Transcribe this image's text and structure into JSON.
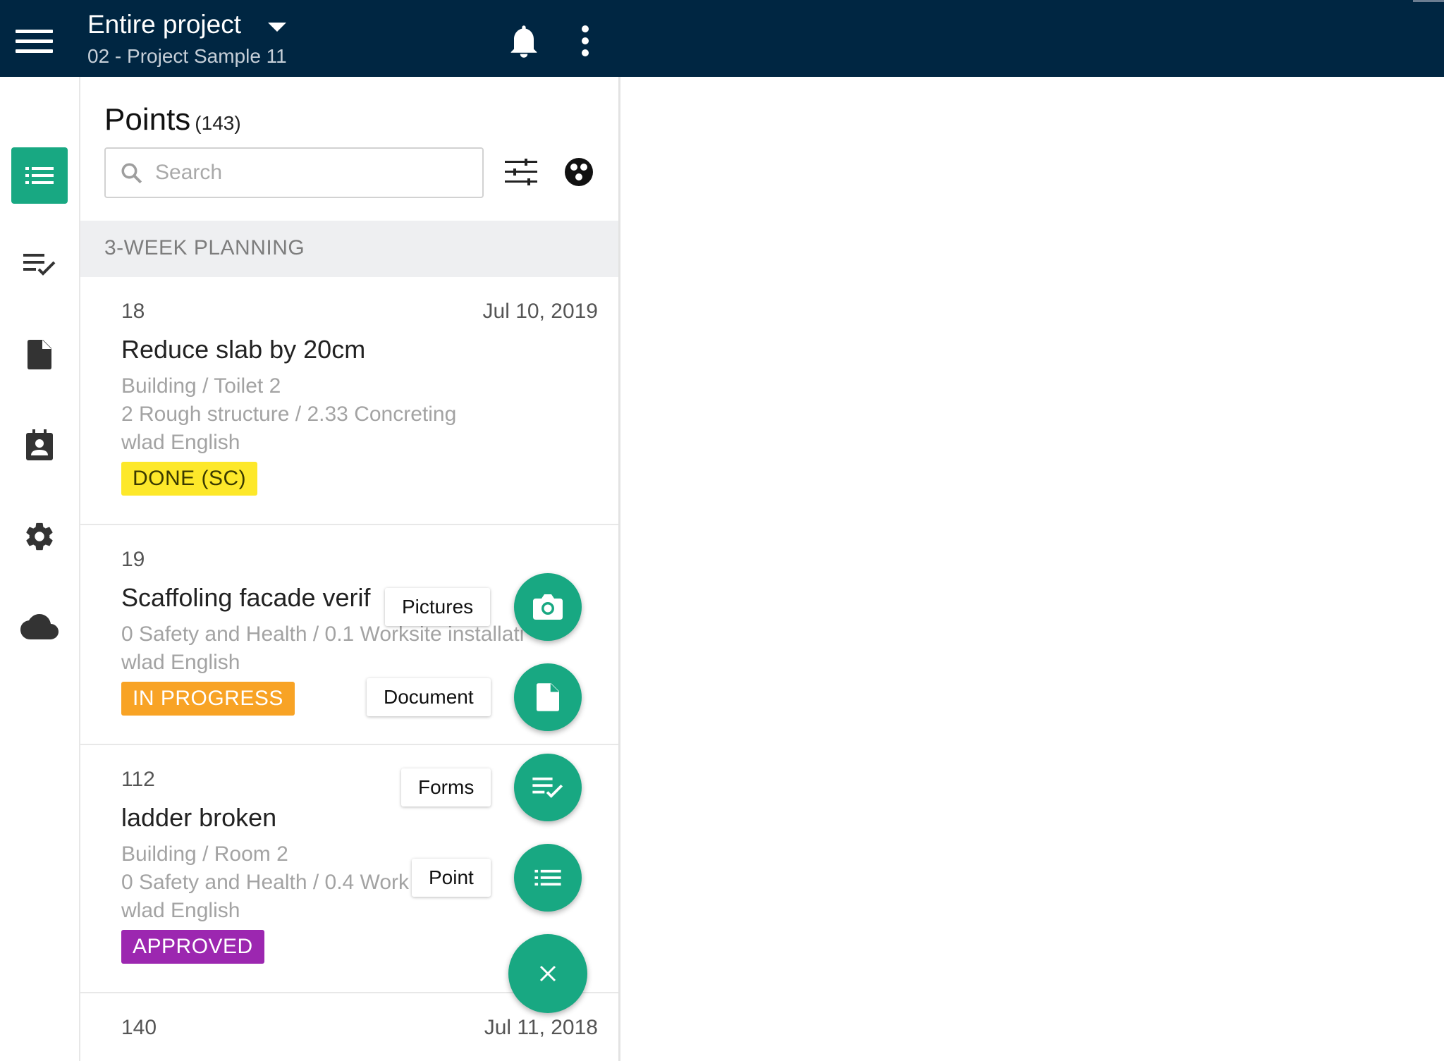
{
  "header": {
    "title": "Entire project",
    "subtitle": "02 - Project Sample 11",
    "menu_icon": "hamburger-menu-icon",
    "caret_icon": "caret-down-icon",
    "notification_icon": "bell-icon",
    "more_icon": "more-vert-icon"
  },
  "rail": {
    "items": [
      {
        "icon": "list-icon",
        "active": true
      },
      {
        "icon": "checklist-icon",
        "active": false
      },
      {
        "icon": "document-icon",
        "active": false
      },
      {
        "icon": "contact-card-icon",
        "active": false
      },
      {
        "icon": "gear-icon",
        "active": false
      },
      {
        "icon": "cloud-icon",
        "active": false
      }
    ]
  },
  "points": {
    "title": "Points",
    "count": "(143)",
    "search_placeholder": "Search",
    "section": "3-WEEK PLANNING"
  },
  "cards": [
    {
      "number": "18",
      "date": "Jul 10, 2019",
      "title": "Reduce slab by 20cm",
      "lines": [
        "Building / Toilet 2",
        "2 Rough structure / 2.33 Concreting",
        "wlad English"
      ],
      "status": "DONE (SC)",
      "status_bg": "#fde82a",
      "status_fg": "#3a3a00"
    },
    {
      "number": "19",
      "date": "",
      "title": "Scaffoling facade verif",
      "lines": [
        "0 Safety and Health / 0.1 Worksite installati",
        "wlad English"
      ],
      "status": "IN PROGRESS",
      "status_bg": "#f8a325",
      "status_fg": "#ffffff"
    },
    {
      "number": "112",
      "date": "",
      "title": "ladder broken",
      "lines": [
        "Building / Room 2",
        "0 Safety and Health / 0.4 Work",
        "wlad English"
      ],
      "status": "APPROVED",
      "status_bg": "#9c27b0",
      "status_fg": "#ffffff"
    },
    {
      "number": "140",
      "date": "Jul 11, 2018",
      "title": "",
      "lines": [],
      "status": "",
      "status_bg": "",
      "status_fg": ""
    }
  ],
  "fab": {
    "actions": [
      {
        "label": "Pictures",
        "icon": "camera-icon"
      },
      {
        "label": "Document",
        "icon": "document-icon"
      },
      {
        "label": "Forms",
        "icon": "checklist-icon"
      },
      {
        "label": "Point",
        "icon": "list-icon"
      }
    ],
    "close_icon": "close-icon",
    "accent": "#18a882"
  },
  "colors": {
    "topbar": "#002642",
    "accent": "#18a882"
  }
}
